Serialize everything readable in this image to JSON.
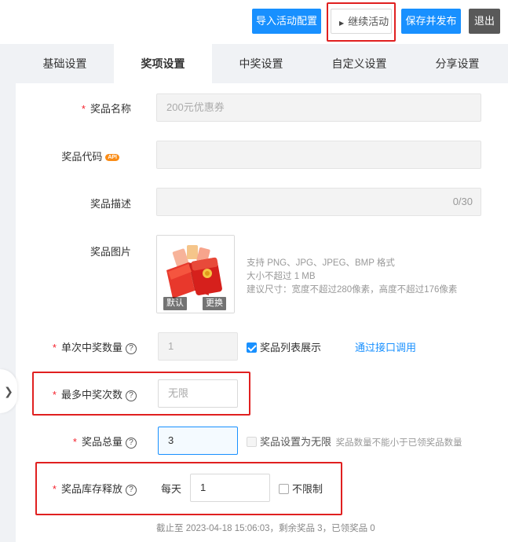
{
  "toolbar": {
    "import_label": "导入活动配置",
    "continue_label": "继续活动",
    "save_publish_label": "保存并发布",
    "exit_label": "退出"
  },
  "tabs": [
    "基础设置",
    "奖项设置",
    "中奖设置",
    "自定义设置",
    "分享设置"
  ],
  "active_tab": "奖项设置",
  "form": {
    "prize_name": {
      "label": "奖品名称",
      "value": "200元优惠券"
    },
    "prize_code": {
      "label": "奖品代码",
      "badge": "API",
      "value": ""
    },
    "prize_desc": {
      "label": "奖品描述",
      "value": "",
      "counter": "0/30"
    },
    "prize_image": {
      "label": "奖品图片",
      "default_label": "默认",
      "change_label": "更换",
      "hint_formats": "支持 PNG、JPG、JPEG、BMP 格式",
      "hint_size": "大小不超过 1 MB",
      "hint_dims": "建议尺寸：宽度不超过280像素，高度不超过176像素"
    },
    "per_win_count": {
      "label": "单次中奖数量",
      "value": "1",
      "show_in_list_label": "奖品列表展示",
      "api_link": "通过接口调用"
    },
    "max_wins": {
      "label": "最多中奖次数",
      "placeholder": "无限"
    },
    "total_prizes": {
      "label": "奖品总量",
      "value": "3",
      "unlimited_label": "奖品设置为无限",
      "unlimited_hint": "奖品数量不能小于已领奖品数量"
    },
    "stock_release": {
      "label": "奖品库存释放",
      "prefix": "每天",
      "value": "1",
      "no_limit_label": "不限制"
    },
    "status_line": "截止至 2023-04-18 15:06:03，剩余奖品 3，已领奖品 0"
  },
  "help_glyph": "?",
  "required_mark": "*",
  "side_handle_icon": "chevron-right-icon",
  "colors": {
    "primary": "#1890ff",
    "required": "#f5222d",
    "annotation": "#e02020",
    "exit": "#595959"
  }
}
